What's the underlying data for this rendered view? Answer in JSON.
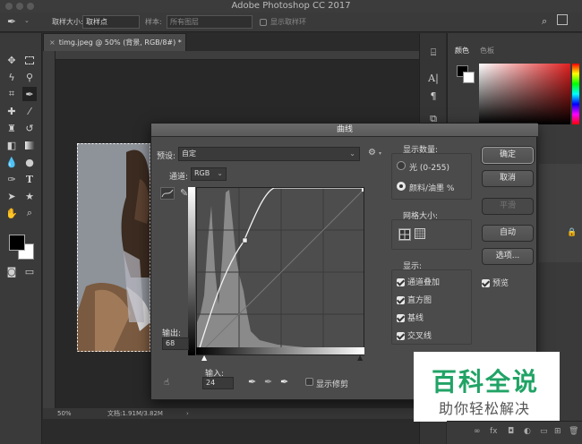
{
  "app": {
    "title": "Adobe Photoshop CC 2017"
  },
  "options_bar": {
    "sample_size_label": "取样大小:",
    "sample_size_value": "取样点",
    "sample_label": "样本:",
    "sample_value": "所有图层",
    "show_ring_label": "显示取样环"
  },
  "document": {
    "tab_label": "timg.jpeg @ 50% (背景, RGB/8#) *",
    "zoom": "50%",
    "doc_info": "文档:1.91M/3.82M"
  },
  "right_panel": {
    "tabs": [
      "颜色",
      "色板"
    ]
  },
  "curves": {
    "title": "曲线",
    "preset_label": "预设:",
    "preset_value": "自定",
    "channel_label": "通道:",
    "channel_value": "RGB",
    "output_label": "输出:",
    "output_value": "68",
    "input_label": "输入:",
    "input_value": "24",
    "show_clipping_label": "显示修剪",
    "show_amount": {
      "title": "显示数量:",
      "light_label": "光 (0-255)",
      "pigment_label": "颜料/油墨 %",
      "selected": "pigment"
    },
    "grid_size": {
      "title": "网格大小:"
    },
    "show": {
      "title": "显示:",
      "items": [
        {
          "label": "通道叠加",
          "checked": true
        },
        {
          "label": "直方图",
          "checked": true
        },
        {
          "label": "基线",
          "checked": true
        },
        {
          "label": "交叉线",
          "checked": true
        }
      ]
    },
    "buttons": {
      "ok": "确定",
      "cancel": "取消",
      "smooth": "平滑",
      "auto": "自动",
      "options": "选项..."
    },
    "preview_label": "预览",
    "preview_checked": true
  },
  "watermark": {
    "main": "百科全说",
    "sub": "助你轻松解决"
  },
  "colors": {
    "bg": "#2b2b2b",
    "panel": "#3a3a3a",
    "dialog": "#4b4b4b",
    "watermark_green": "#21a366"
  }
}
